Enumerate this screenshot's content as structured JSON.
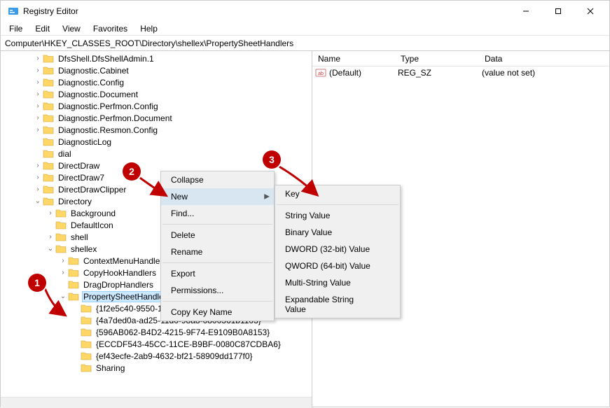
{
  "window": {
    "title": "Registry Editor"
  },
  "menubar": [
    "File",
    "Edit",
    "View",
    "Favorites",
    "Help"
  ],
  "address": "Computer\\HKEY_CLASSES_ROOT\\Directory\\shellex\\PropertySheetHandlers",
  "tree": [
    {
      "depth": 2,
      "exp": ">",
      "label": "DfsShell.DfsShellAdmin.1"
    },
    {
      "depth": 2,
      "exp": ">",
      "label": "Diagnostic.Cabinet"
    },
    {
      "depth": 2,
      "exp": ">",
      "label": "Diagnostic.Config"
    },
    {
      "depth": 2,
      "exp": ">",
      "label": "Diagnostic.Document"
    },
    {
      "depth": 2,
      "exp": ">",
      "label": "Diagnostic.Perfmon.Config"
    },
    {
      "depth": 2,
      "exp": ">",
      "label": "Diagnostic.Perfmon.Document"
    },
    {
      "depth": 2,
      "exp": ">",
      "label": "Diagnostic.Resmon.Config"
    },
    {
      "depth": 2,
      "exp": "",
      "label": "DiagnosticLog"
    },
    {
      "depth": 2,
      "exp": "",
      "label": "dial"
    },
    {
      "depth": 2,
      "exp": ">",
      "label": "DirectDraw"
    },
    {
      "depth": 2,
      "exp": ">",
      "label": "DirectDraw7"
    },
    {
      "depth": 2,
      "exp": ">",
      "label": "DirectDrawClipper"
    },
    {
      "depth": 2,
      "exp": "v",
      "label": "Directory"
    },
    {
      "depth": 3,
      "exp": ">",
      "label": "Background"
    },
    {
      "depth": 3,
      "exp": "",
      "label": "DefaultIcon"
    },
    {
      "depth": 3,
      "exp": ">",
      "label": "shell"
    },
    {
      "depth": 3,
      "exp": "v",
      "label": "shellex"
    },
    {
      "depth": 4,
      "exp": ">",
      "label": "ContextMenuHandlers"
    },
    {
      "depth": 4,
      "exp": ">",
      "label": "CopyHookHandlers"
    },
    {
      "depth": 4,
      "exp": "",
      "label": "DragDropHandlers"
    },
    {
      "depth": 4,
      "exp": "v",
      "label": "PropertySheetHandlers",
      "selected": true
    },
    {
      "depth": 5,
      "exp": "",
      "label": "{1f2e5c40-9550-11ce-99d2-00aa006e086c}"
    },
    {
      "depth": 5,
      "exp": "",
      "label": "{4a7ded0a-ad25-11d0-98a8-0800361b1103}"
    },
    {
      "depth": 5,
      "exp": "",
      "label": "{596AB062-B4D2-4215-9F74-E9109B0A8153}"
    },
    {
      "depth": 5,
      "exp": "",
      "label": "{ECCDF543-45CC-11CE-B9BF-0080C87CDBA6}"
    },
    {
      "depth": 5,
      "exp": "",
      "label": "{ef43ecfe-2ab9-4632-bf21-58909dd177f0}"
    },
    {
      "depth": 5,
      "exp": "",
      "label": "Sharing"
    }
  ],
  "list": {
    "headers": {
      "name": "Name",
      "type": "Type",
      "data": "Data"
    },
    "rows": [
      {
        "name": "(Default)",
        "type": "REG_SZ",
        "data": "(value not set)"
      }
    ]
  },
  "context_menu_1": [
    {
      "label": "Collapse"
    },
    {
      "label": "New",
      "submenu": true,
      "hover": true
    },
    {
      "label": "Find..."
    },
    {
      "sep": true
    },
    {
      "label": "Delete"
    },
    {
      "label": "Rename"
    },
    {
      "sep": true
    },
    {
      "label": "Export"
    },
    {
      "label": "Permissions..."
    },
    {
      "sep": true
    },
    {
      "label": "Copy Key Name"
    }
  ],
  "submenu": [
    {
      "label": "Key"
    },
    {
      "sep": true
    },
    {
      "label": "String Value"
    },
    {
      "label": "Binary Value"
    },
    {
      "label": "DWORD (32-bit) Value"
    },
    {
      "label": "QWORD (64-bit) Value"
    },
    {
      "label": "Multi-String Value"
    },
    {
      "label": "Expandable String Value"
    }
  ],
  "callouts": {
    "b1": "1",
    "b2": "2",
    "b3": "3"
  }
}
